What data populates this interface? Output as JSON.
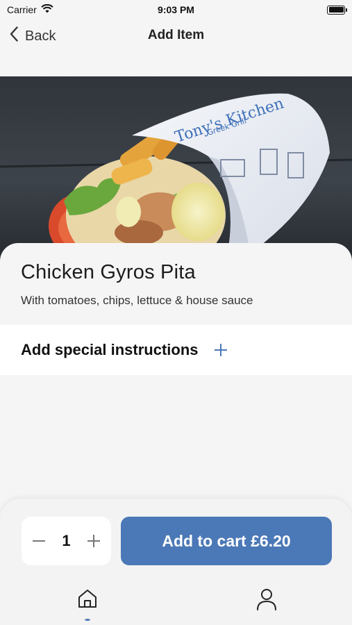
{
  "status_bar": {
    "carrier": "Carrier",
    "time": "9:03 PM"
  },
  "nav": {
    "back_label": "Back",
    "title": "Add Item"
  },
  "product": {
    "name": "Chicken Gyros Pita",
    "description": "With tomatoes, chips, lettuce & house sauce",
    "wrapper_brand": "Tony's Kitchen",
    "wrapper_sub": "Greek Grill"
  },
  "instructions": {
    "label": "Add special instructions"
  },
  "cart": {
    "quantity": "1",
    "add_label": "Add to cart £6.20"
  },
  "tabs": {
    "active": "home"
  },
  "colors": {
    "accent": "#4b78b7",
    "background": "#f5f5f5"
  }
}
